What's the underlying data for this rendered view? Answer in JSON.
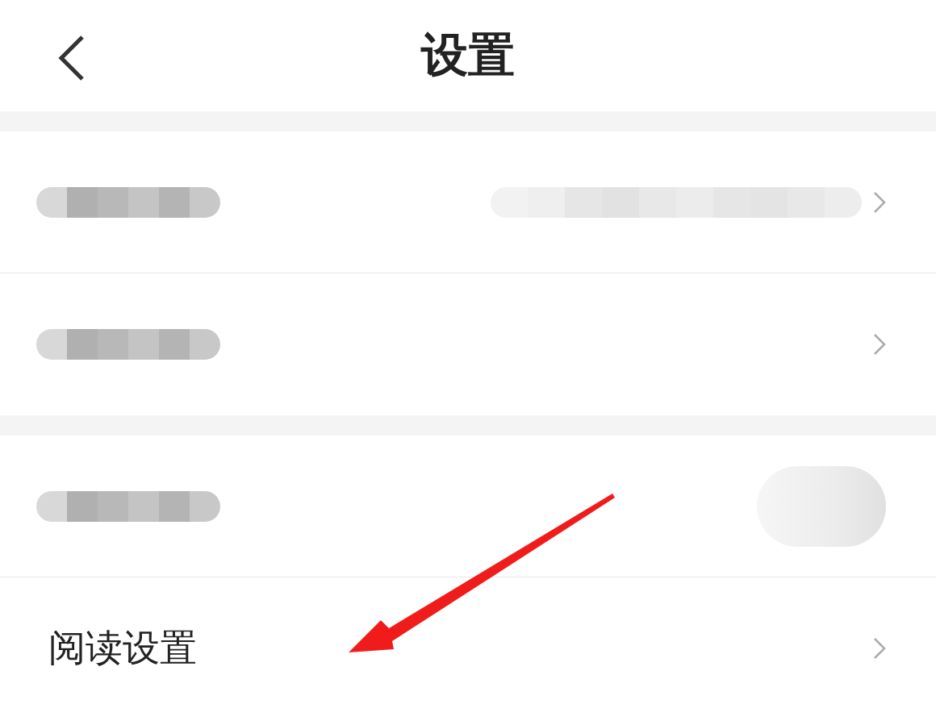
{
  "header": {
    "title": "设置"
  },
  "sections": [
    {
      "rows": [
        {
          "kind": "blurred-value"
        },
        {
          "kind": "blurred"
        }
      ]
    },
    {
      "rows": [
        {
          "kind": "blurred-toggle"
        },
        {
          "kind": "text",
          "label": "阅读设置"
        }
      ]
    }
  ]
}
